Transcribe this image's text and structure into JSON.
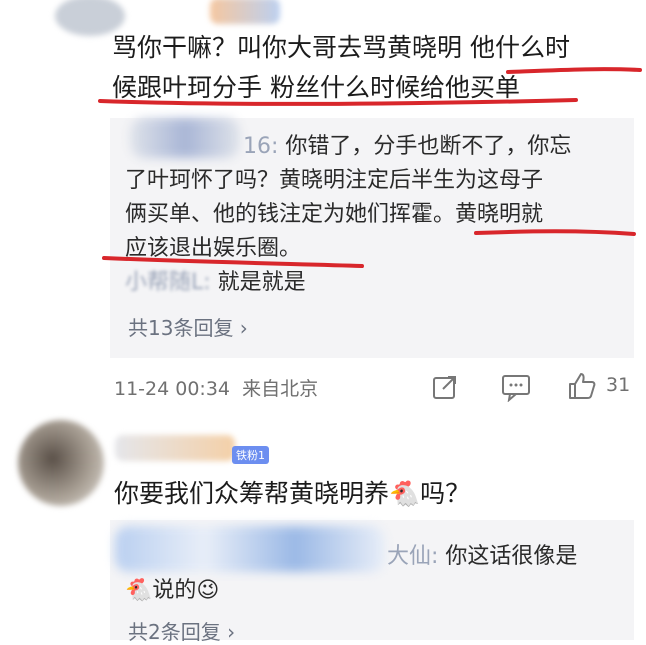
{
  "comment1": {
    "line1": "骂你干嘛？叫你大哥去骂黄晓明 他什么时",
    "line2": "候跟叶珂分手 粉丝什么时候给他买单"
  },
  "reply1": {
    "name_suffix": "16:",
    "line1": "你错了，分手也断不了，你忘",
    "line2": "了叶珂怀了吗？黄晓明注定后半生为这母子",
    "line3": "俩买单、他的钱注定为她们挥霍。黄晓明就",
    "line4": "应该退出娱乐圈。"
  },
  "reply2": {
    "name": "小帮随L:",
    "text": "就是就是"
  },
  "replies_more1": "共13条回复 ›",
  "meta1": {
    "date": "11-24 00:34",
    "location": "来自北京",
    "likes": "31"
  },
  "comment2": {
    "badge": "铁粉1",
    "text": "你要我们众筹帮黄晓明养🐔吗？"
  },
  "reply3": {
    "name_suffix": "大仙:",
    "line1": "你这话很像是",
    "line2": "🐔说的😉"
  },
  "replies_more2": "共2条回复 ›"
}
